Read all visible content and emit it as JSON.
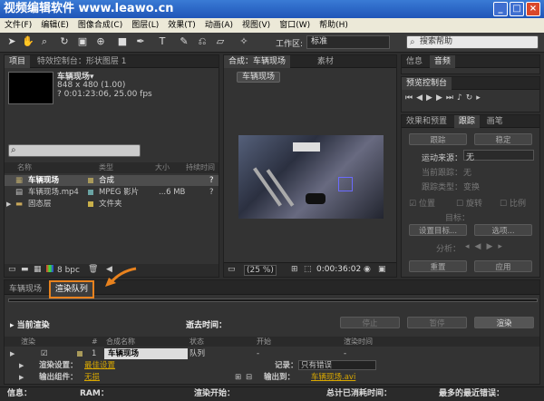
{
  "window": {
    "title": "视频编辑软件  www.leawo.cn",
    "min": "_",
    "max": "□",
    "close": "×"
  },
  "menu": [
    "文件(F)",
    "编辑(E)",
    "图像合成(C)",
    "图层(L)",
    "效果(T)",
    "动画(A)",
    "视图(V)",
    "窗口(W)",
    "帮助(H)"
  ],
  "toolbar": {
    "workspace_label": "工作区:",
    "workspace_value": "标准",
    "search_placeholder": "搜索帮助"
  },
  "project": {
    "tab": "项目",
    "tab2": "特效控制台：形状图层 1",
    "comp_name": "车辆现场▾",
    "comp_size": "848 x 480 (1.00)",
    "comp_duration": "? 0:01:23:06, 25.00 fps",
    "search_placeholder": "",
    "columns": [
      "名称",
      "类型",
      "大小",
      "持续时间"
    ],
    "items": [
      {
        "name": "车辆现场",
        "type": "合成",
        "size": "",
        "duration": "?"
      },
      {
        "name": "车辆现场.mp4",
        "type": "MPEG 影片",
        "size": "...6 MB",
        "duration": "?"
      },
      {
        "name": "固态层",
        "type": "文件夹",
        "size": "",
        "duration": ""
      }
    ],
    "bpc": "8 bpc"
  },
  "composition": {
    "tab": "合成：车辆现场",
    "tab2": "素材",
    "breadcrumb": "车辆现场",
    "zoom": "(25 %)",
    "timecode": "0:00:36:02"
  },
  "info": {
    "tab1": "信息",
    "tab2": "音频"
  },
  "preview": {
    "tab": "预览控制台"
  },
  "effects": {
    "tab1": "效果和预置",
    "tab2": "跟踪",
    "tab3": "画笔",
    "track_btn": "跟踪",
    "stabilize_btn": "稳定",
    "motion_source_label": "运动来源：",
    "motion_source_value": "无",
    "current_track_label": "当前跟踪：",
    "current_track_value": "无",
    "track_type_label": "跟踪类型：",
    "track_type_value": "变换",
    "position": "位置",
    "rotation": "旋转",
    "scale": "比例",
    "target_label": "目标：",
    "set_target": "设置目标...",
    "options": "选项...",
    "analyze": "分析：",
    "reset": "重置",
    "apply": "应用"
  },
  "timeline": {
    "tab1": "车辆现场",
    "tab2": "渲染队列",
    "current_render": "当前渲染",
    "elapsed": "逝去时间：",
    "stop": "停止",
    "pause": "暂停",
    "render": "渲染",
    "columns": [
      "渲染",
      "#",
      "合成名称",
      "状态",
      "开始",
      "渲染时间"
    ],
    "row": {
      "num": "1",
      "name": "车辆现场",
      "status": "队列",
      "start": "-",
      "time": "-"
    },
    "render_settings_label": "渲染设置：",
    "render_settings_value": "最佳设置",
    "log_label": "记录：",
    "log_value": "只有错误",
    "output_module_label": "输出组件：",
    "output_module_value": "无损",
    "output_to_label": "输出到：",
    "output_to_value": "车辆现场.avi"
  },
  "status": {
    "info": "信息：",
    "ram": "RAM：",
    "render_start": "渲染开始：",
    "total_time": "总计已消耗时间：",
    "recent_error": "最多的最近错误："
  },
  "colors": {
    "accent_orange": "#e8821e",
    "yellow_text": "#d9a800"
  }
}
